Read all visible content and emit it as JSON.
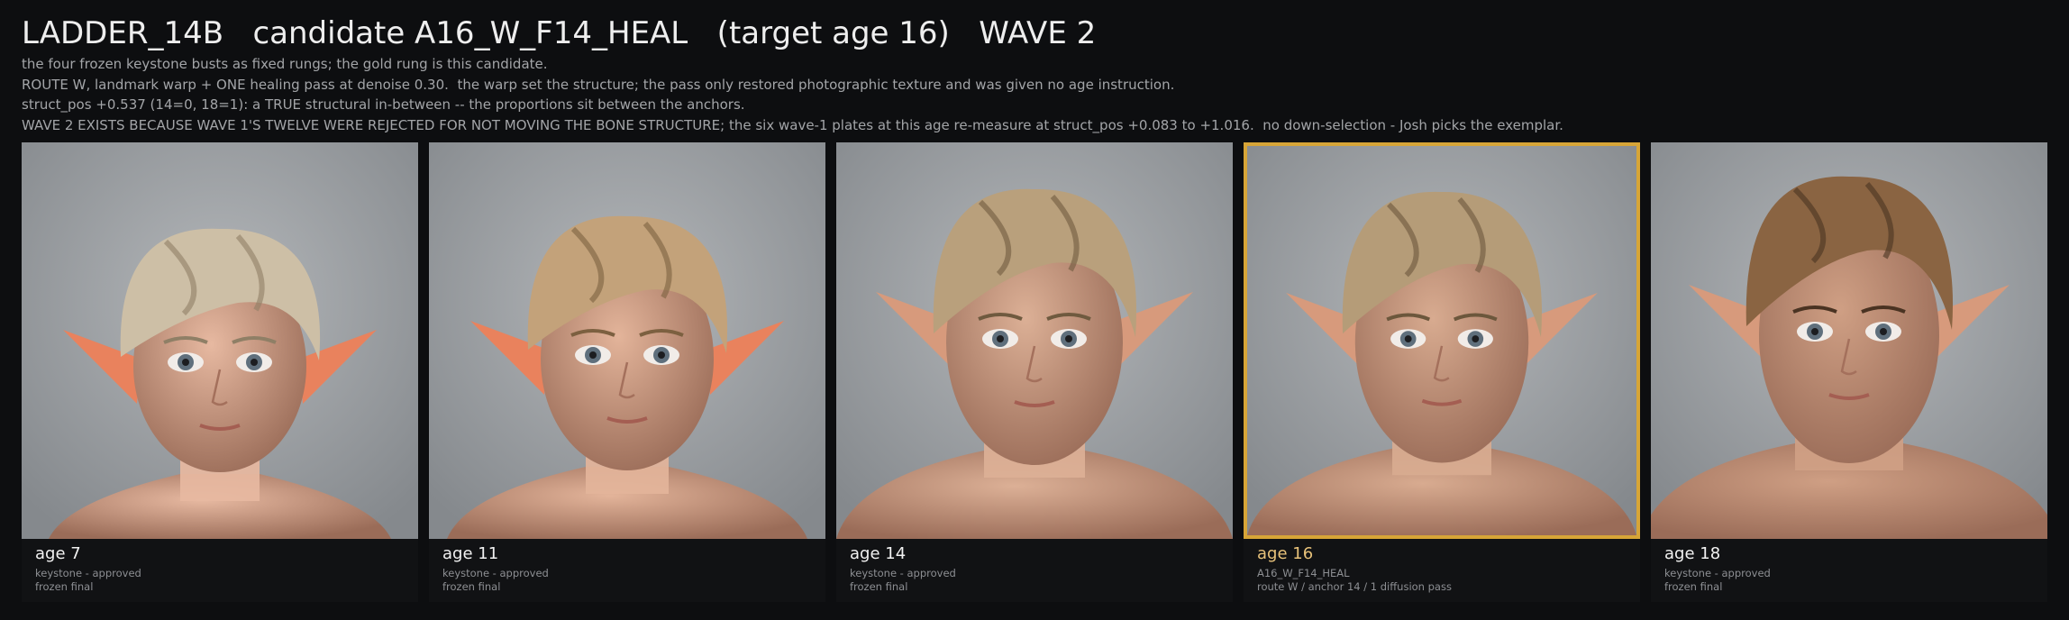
{
  "header": {
    "title": "LADDER_14B   candidate A16_W_F14_HEAL   (target age 16)   WAVE 2",
    "lines": [
      "the four frozen keystone busts as fixed rungs; the gold rung is this candidate.",
      "ROUTE W, landmark warp + ONE healing pass at denoise 0.30.  the warp set the structure; the pass only restored photographic texture and was given no age instruction.",
      "struct_pos +0.537 (14=0, 18=1): a TRUE structural in-between -- the proportions sit between the anchors.",
      "WAVE 2 EXISTS BECAUSE WAVE 1'S TWELVE WERE REJECTED FOR NOT MOVING THE BONE STRUCTURE; the six wave-1 plates at this age re-measure at struct_pos +0.083 to +1.016.  no down-selection - Josh picks the exemplar."
    ]
  },
  "colors": {
    "background": "#0d0e10",
    "highlight": "#d7a537",
    "highlight_text": "#e8c27a"
  },
  "rungs": [
    {
      "label": "age 7",
      "line1": "keystone - approved",
      "line2": "frozen final",
      "selected": false,
      "hair": "#cdbfa6",
      "hair_dark": "#8f7f66",
      "skin": "#e7b9a1"
    },
    {
      "label": "age 11",
      "line1": "keystone - approved",
      "line2": "frozen final",
      "selected": false,
      "hair": "#c3a27a",
      "hair_dark": "#7c6040",
      "skin": "#e3b49a"
    },
    {
      "label": "age 14",
      "line1": "keystone - approved",
      "line2": "frozen final",
      "selected": false,
      "hair": "#b9a07c",
      "hair_dark": "#6f5a3f",
      "skin": "#dcb096"
    },
    {
      "label": "age 16",
      "line1": "A16_W_F14_HEAL",
      "line2": "route W / anchor 14 / 1 diffusion pass",
      "selected": true,
      "hair": "#b59c78",
      "hair_dark": "#6c573c",
      "skin": "#d8ab90"
    },
    {
      "label": "age 18",
      "line1": "keystone - approved",
      "line2": "frozen final",
      "selected": false,
      "hair": "#8a6442",
      "hair_dark": "#4a3322",
      "skin": "#cf9f84"
    }
  ]
}
